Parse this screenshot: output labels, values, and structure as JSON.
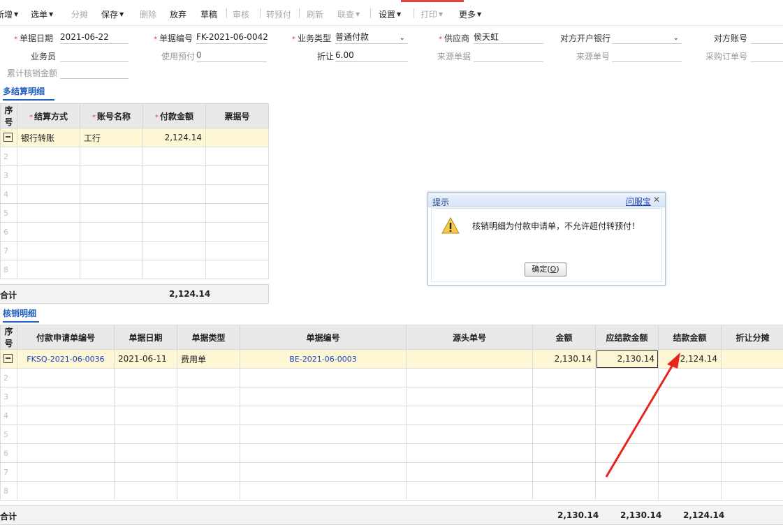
{
  "toolbar": {
    "items": [
      {
        "label": "新增",
        "caret": true,
        "disabled": false
      },
      {
        "label": "选单",
        "caret": true,
        "disabled": false
      },
      {
        "label": "分摊",
        "caret": false,
        "disabled": true
      },
      {
        "label": "保存",
        "caret": true,
        "disabled": false
      },
      {
        "label": "删除",
        "caret": false,
        "disabled": true
      },
      {
        "label": "放弃",
        "caret": false,
        "disabled": false
      },
      {
        "label": "草稿",
        "caret": false,
        "disabled": false
      },
      {
        "label": "审核",
        "caret": false,
        "disabled": true
      },
      {
        "label": "转预付",
        "caret": false,
        "disabled": true
      },
      {
        "label": "刷新",
        "caret": false,
        "disabled": true
      },
      {
        "label": "联查",
        "caret": true,
        "disabled": true
      },
      {
        "label": "设置",
        "caret": true,
        "disabled": false
      },
      {
        "label": "打印",
        "caret": true,
        "disabled": true
      },
      {
        "label": "更多",
        "caret": true,
        "disabled": false
      }
    ]
  },
  "form": {
    "date_label": "单据日期",
    "date_value": "2021-06-22",
    "docno_label": "单据编号",
    "docno_value": "FK-2021-06-0042",
    "biztype_label": "业务类型",
    "biztype_value": "普通付款",
    "supplier_label": "供应商",
    "supplier_value": "侯天虹",
    "bank_label": "对方开户银行",
    "bank_value": "",
    "account_label": "对方账号",
    "account_value": "",
    "salesman_label": "业务员",
    "salesman_value": "",
    "prepay_label": "使用预付",
    "prepay_value": "0",
    "discount_label": "折让",
    "discount_value": "6.00",
    "source_label": "来源单据",
    "source_value": "",
    "sourceno_label": "来源单号",
    "sourceno_value": "",
    "po_label": "采购订单号",
    "po_value": "",
    "cum_label": "累计核销金额",
    "cum_value": ""
  },
  "settlement": {
    "tab_label": "多结算明细",
    "headers": [
      "序号",
      "结算方式",
      "账号名称",
      "付款金额",
      "票据号"
    ],
    "row1": {
      "method": "银行转账",
      "account": "工行",
      "amount": "2,124.14",
      "ticket": ""
    },
    "empty_rows": [
      "2",
      "3",
      "4",
      "5",
      "6",
      "7",
      "8"
    ],
    "total_label": "合计",
    "total_amount": "2,124.14"
  },
  "writeoff": {
    "tab_label": "核销明细",
    "headers": [
      "序号",
      "付款申请单编号",
      "单据日期",
      "单据类型",
      "单据编号",
      "源头单号",
      "金额",
      "应结款金额",
      "结款金额",
      "折让分摊"
    ],
    "row1": {
      "apply_no": "FKSQ-2021-06-0036",
      "date": "2021-06-11",
      "type": "费用单",
      "doc_no": "BE-2021-06-0003",
      "origin_no": "",
      "amount": "2,130.14",
      "due": "2,130.14",
      "paid": "2,124.14",
      "disc": ""
    },
    "empty_rows": [
      "2",
      "3",
      "4",
      "5",
      "6",
      "7",
      "8"
    ],
    "total_label": "合计",
    "total_amount": "2,130.14",
    "total_due": "2,130.14",
    "total_paid": "2,124.14"
  },
  "dialog": {
    "title": "提示",
    "help": "问服宝",
    "close": "✕",
    "message": "核销明细为付款申请单，不允许超付转预付！",
    "ok_label": "确定(",
    "ok_key": "O",
    "ok_end": ")"
  },
  "colors": {
    "accent": "#e0413d",
    "link": "#1f3fbf",
    "tab": "#1f5fbf",
    "selected_row": "#fdf7d6",
    "arrow": "#e8251c"
  }
}
